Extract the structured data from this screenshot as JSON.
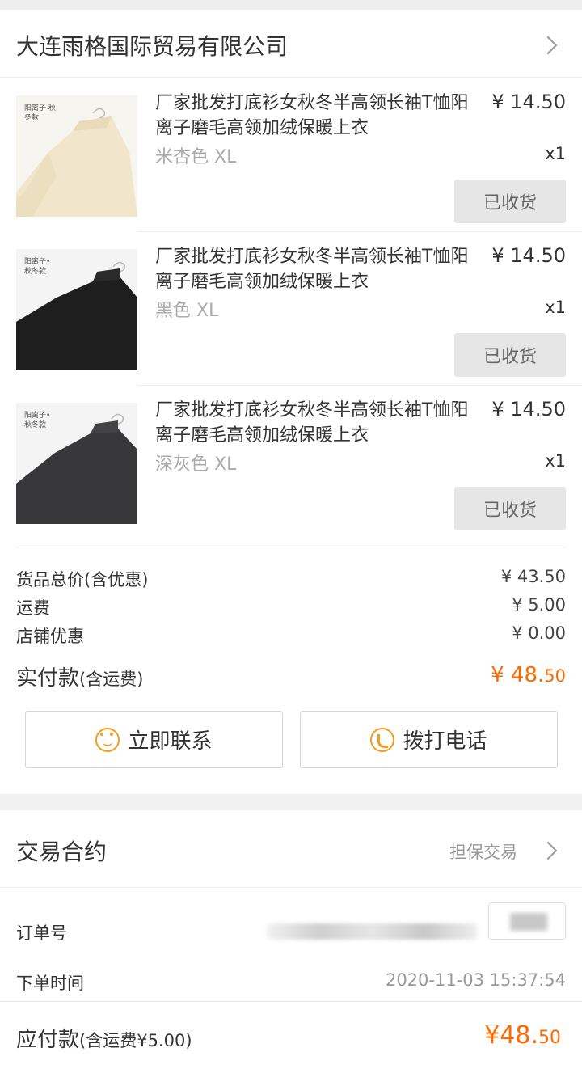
{
  "shop": {
    "name": "大连雨格国际贸易有限公司"
  },
  "items": [
    {
      "title": "厂家批发打底衫女秋冬半高领长袖T恤阳离子磨毛高领加绒保暖上衣",
      "price": "¥ 14.50",
      "spec": "米杏色 XL",
      "qty": "x1",
      "status": "已收货",
      "thumb_tag": "阳离子 秋冬款",
      "color": "#f3ead3"
    },
    {
      "title": "厂家批发打底衫女秋冬半高领长袖T恤阳离子磨毛高领加绒保暖上衣",
      "price": "¥ 14.50",
      "spec": "黑色 XL",
      "qty": "x1",
      "status": "已收货",
      "thumb_tag": "阳离子• 秋冬款",
      "color": "#1e1e1e"
    },
    {
      "title": "厂家批发打底衫女秋冬半高领长袖T恤阳离子磨毛高领加绒保暖上衣",
      "price": "¥ 14.50",
      "spec": "深灰色 XL",
      "qty": "x1",
      "status": "已收货",
      "thumb_tag": "阳离子• 秋冬款",
      "color": "#3a3a3c"
    }
  ],
  "summary": {
    "goods_total_label": "货品总价(含优惠)",
    "goods_total_value": "¥ 43.50",
    "shipping_label": "运费",
    "shipping_value": "¥ 5.00",
    "discount_label": "店铺优惠",
    "discount_value": "¥ 0.00",
    "paid_label": "实付款",
    "paid_sub": "(含运费)",
    "paid_main": "¥ 48.",
    "paid_small": "50"
  },
  "actions": {
    "contact": "立即联系",
    "call": "拨打电话"
  },
  "contract": {
    "title": "交易合约",
    "type": "担保交易"
  },
  "order": {
    "id_label": "订单号",
    "time_label": "下单时间",
    "time_value": "2020-11-03 15:37:54"
  },
  "footer": {
    "label": "应付款",
    "sub": "(含运费¥5.00)",
    "main": "¥48.",
    "small": "50"
  },
  "colors": {
    "accent": "#ff6a00",
    "icon": "#f39c1f"
  }
}
